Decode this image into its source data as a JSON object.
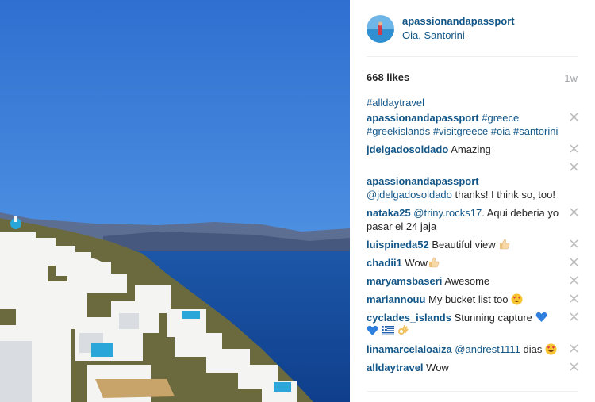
{
  "post": {
    "owner": "apassionandapassport",
    "location": "Oia, Santorini",
    "likes": "668 likes",
    "age": "1w",
    "caption_line": "#alldaytravel"
  },
  "comments": [
    {
      "user": "apassionandapassport",
      "text": "#greece #greekislands #visitgreece #oia #santorini"
    },
    {
      "user": "jdelgadosoldado",
      "text": "Amazing"
    },
    {
      "user": "apassionandapassport",
      "mention": "@jdelgadosoldado",
      "text": "thanks! I think so, too!"
    },
    {
      "user": "nataka25",
      "mention": "@triny.rocks17",
      "text": ". Aqui deberia yo pasar el 24 jaja"
    },
    {
      "user": "luispineda52",
      "text": "Beautiful view"
    },
    {
      "user": "chadii1",
      "text": "Wow"
    },
    {
      "user": "maryamsbaseri",
      "text": "Awesome"
    },
    {
      "user": "mariannouu",
      "text": "My bucket list too"
    },
    {
      "user": "cyclades_islands",
      "text": "Stunning capture"
    },
    {
      "user": "linamarcelaloaiza",
      "mention": "@andrest1111",
      "text": "dias"
    },
    {
      "user": "alldaytravel",
      "text": "Wow"
    }
  ],
  "icons": {
    "delete": "close-icon",
    "thumbs_up": "thumbs-up-emoji-icon",
    "heart_eyes": "heart-eyes-emoji-icon",
    "blue_heart": "blue-heart-emoji-icon",
    "greek_flag": "greece-flag-emoji-icon",
    "ok_hand": "ok-hand-emoji-icon"
  },
  "colors": {
    "link": "#125688",
    "text": "#262626",
    "muted": "#a5a7aa",
    "divider": "#efefef"
  }
}
